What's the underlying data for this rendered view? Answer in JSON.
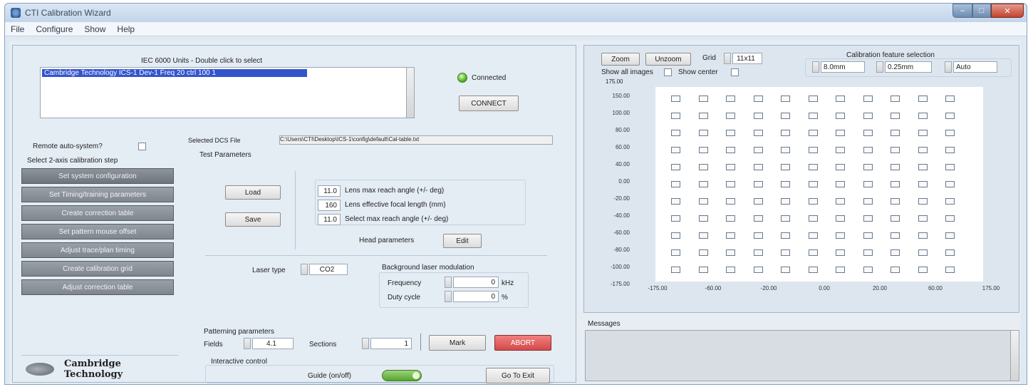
{
  "window": {
    "title": "CTI Calibration Wizard"
  },
  "menu": [
    "File",
    "Configure",
    "Show",
    "Help"
  ],
  "device": {
    "list_title": "IEC 6000 Units - Double click to select",
    "list_items": [
      "Cambridge Technology ICS-1 Dev-1 Freq 20 ctrl 100 1"
    ],
    "connection_label": "Connected",
    "connect_button": "CONNECT"
  },
  "sidebar": {
    "remote_label": "Remote auto-system?",
    "steps_title": "Select 2-axis calibration step",
    "steps": [
      "Set system configuration",
      "Set Timing/training parameters",
      "Create correction table",
      "Set pattern mouse offset",
      "Adjust trace/plan timing",
      "Create calibration grid",
      "Adjust correction table"
    ]
  },
  "logo": {
    "line1": "Cambridge",
    "line2": "Technology"
  },
  "center": {
    "path_label": "Selected DCS File",
    "path_value": "C:\\Users\\CTI\\Desktop\\ICS-1\\config\\default\\Cal-table.txt",
    "test_params_title": "Test Parameters",
    "load_button": "Load",
    "save_button": "Save",
    "params": [
      {
        "value": "11.0",
        "label": "Lens max reach angle (+/- deg)"
      },
      {
        "value": "160",
        "label": "Lens effective focal length (mm)"
      },
      {
        "value": "11.0",
        "label": "Select max reach angle (+/- deg)"
      }
    ],
    "head_label": "Head parameters",
    "head_button": "Edit",
    "laser_label": "Laser type",
    "laser_value": "CO2",
    "modulation_title": "Background laser modulation",
    "frequency_label": "Frequency",
    "frequency_value": "0",
    "frequency_unit": "kHz",
    "duty_label": "Duty cycle",
    "duty_value": "0",
    "duty_unit": "%",
    "patterning_title": "Patterning parameters",
    "fields_label": "Fields",
    "fields_value": "4.1",
    "sections_label": "Sections",
    "sections_value": "1",
    "mark_button": "Mark",
    "abort_button": "ABORT",
    "interactive_title": "Interactive control",
    "guide_label": "Guide (on/off)",
    "go_button": "Go To Exit"
  },
  "plot": {
    "zoom_in": "Zoom",
    "zoom_out": "Unzoom",
    "grid_label": "Grid",
    "grid_value": "11x11",
    "show_all_label": "Show all images",
    "show_center_label": "Show center",
    "cal_title": "Calibration feature selection",
    "sel1": "8.0mm",
    "sel2": "0.25mm",
    "sel3": "Auto",
    "y_top_label": "175.00",
    "y_ticks": [
      "150.00",
      "100.00",
      "80.00",
      "60.00",
      "40.00",
      "0.00",
      "-20.00",
      "-40.00",
      "-60.00",
      "-80.00",
      "-100.00",
      "-175.00"
    ],
    "x_ticks": [
      "-175.00",
      "-60.00",
      "-20.00",
      "0.00",
      "20.00",
      "60.00",
      "175.00"
    ],
    "grid_rows": 11,
    "grid_cols": 11
  },
  "messages": {
    "title": "Messages"
  }
}
